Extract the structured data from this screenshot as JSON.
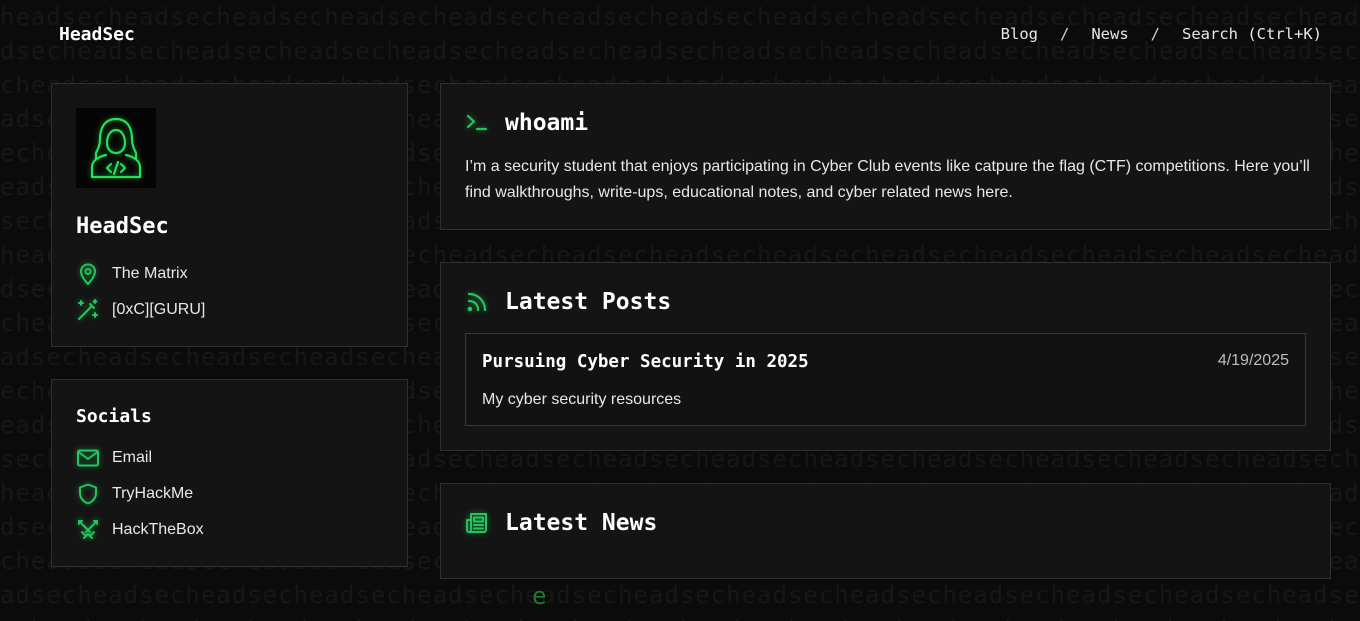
{
  "nav": {
    "brand": "HeadSec",
    "links": [
      "Blog",
      "News",
      "Search (Ctrl+K)"
    ],
    "separator": "/"
  },
  "background": {
    "pattern_text": "headsec",
    "accent_glyph": "e"
  },
  "profile": {
    "name": "HeadSec",
    "location": "The Matrix",
    "rank": "[0xC][GURU]",
    "avatar_icon": "hooded-hacker-icon"
  },
  "socials": {
    "title": "Socials",
    "items": [
      {
        "label": "Email",
        "icon": "mail-icon"
      },
      {
        "label": "TryHackMe",
        "icon": "shield-icon"
      },
      {
        "label": "HackTheBox",
        "icon": "crossed-swords-icon"
      }
    ]
  },
  "whoami": {
    "title": "whoami",
    "text": "I’m a security student that enjoys participating in Cyber Club events like catpure the flag (CTF) competitions. Here you’ll find walkthroughs, write-ups, educational notes, and cyber related news here."
  },
  "posts": {
    "title": "Latest Posts",
    "items": [
      {
        "title": "Pursuing Cyber Security in 2025",
        "date": "4/19/2025",
        "description": "My cyber security resources"
      }
    ]
  },
  "news": {
    "title": "Latest News"
  },
  "colors": {
    "accent": "#22c55e",
    "background": "#0b0b0b",
    "panel": "#141414",
    "border": "#2f2f2f"
  }
}
